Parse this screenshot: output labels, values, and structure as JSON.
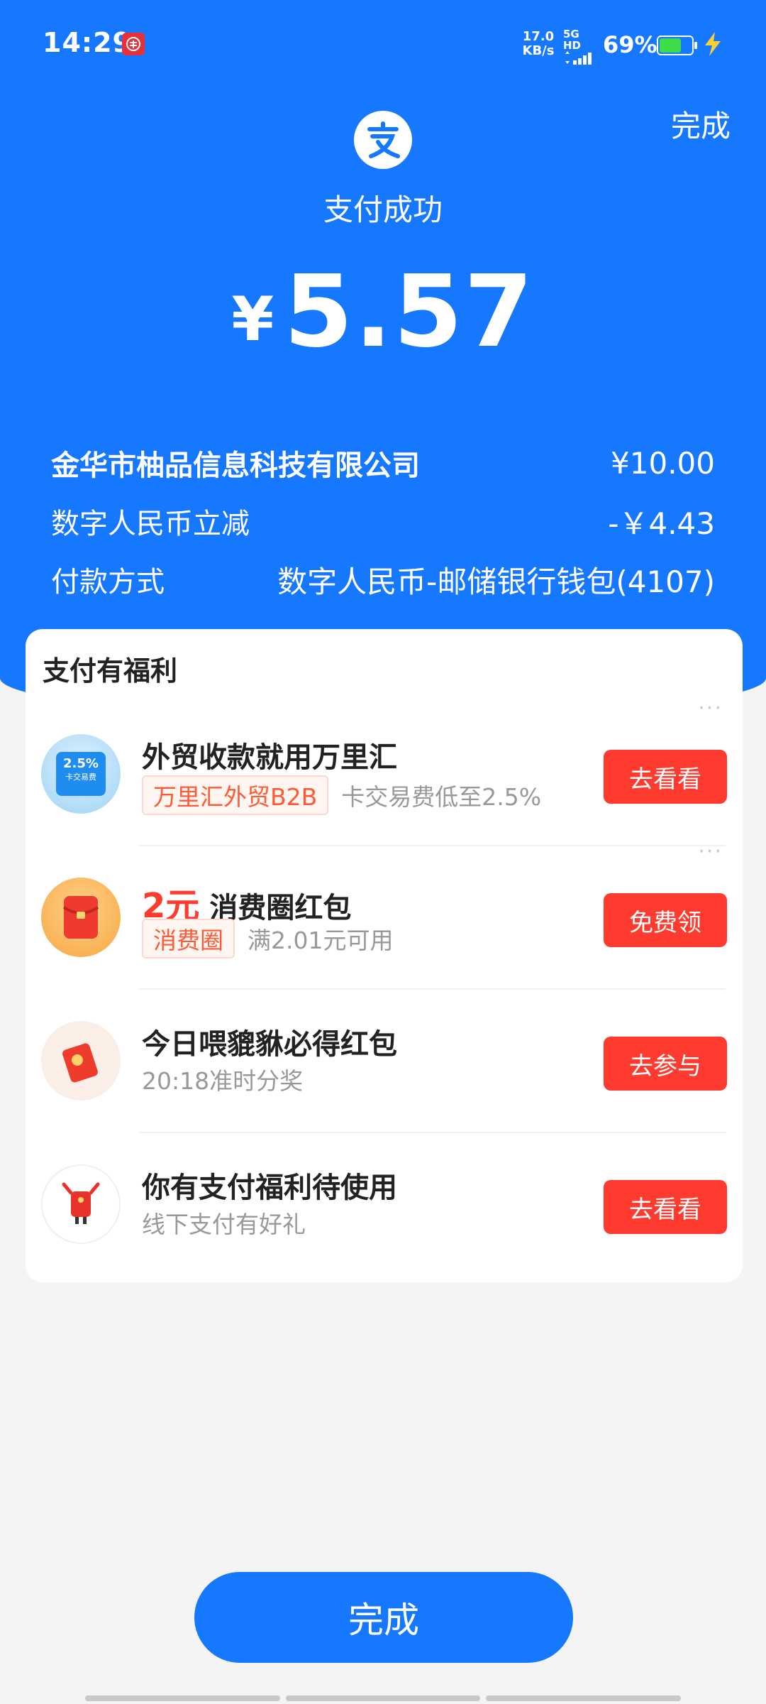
{
  "status_bar": {
    "time": "14:29",
    "net_speed": "17.0",
    "net_speed_unit": "KB/s",
    "network_label": "5G HD",
    "battery": "69%",
    "battery_level": 0.69,
    "icons": [
      "digital-rmb-icon",
      "signal-icon",
      "battery-icon",
      "charging-bolt-icon"
    ]
  },
  "header": {
    "done_label": "完成",
    "status_title": "支付成功",
    "currency": "¥",
    "amount": "5.57"
  },
  "details": [
    {
      "label": "金华市柚品信息科技有限公司",
      "value": "¥10.00"
    },
    {
      "label": "数字人民币立减",
      "value": "-￥4.43"
    },
    {
      "label": "付款方式",
      "value": "数字人民币-邮储银行钱包(4107)"
    }
  ],
  "benefits": {
    "title": "支付有福利",
    "items": [
      {
        "title": "外贸收款就用万里汇",
        "tag": "万里汇外贸B2B",
        "desc": "卡交易费低至2.5%",
        "cta": "去看看",
        "thumb_text": "2.5%",
        "thumb_sub": "卡交易费"
      },
      {
        "title_highlight": "2元",
        "title": "消费圈红包",
        "tag": "消费圈",
        "desc": "满2.01元可用",
        "cta": "免费领"
      },
      {
        "title": "今日喂貔貅必得红包",
        "desc": "20:18准时分奖",
        "cta": "去参与"
      },
      {
        "title": "你有支付福利待使用",
        "desc": "线下支付有好礼",
        "cta": "去看看"
      }
    ]
  },
  "footer": {
    "done_label": "完成"
  },
  "colors": {
    "brand_blue": "#1677ff",
    "cta_red": "#ff3b30",
    "tag_orange": "#ff5a36"
  }
}
